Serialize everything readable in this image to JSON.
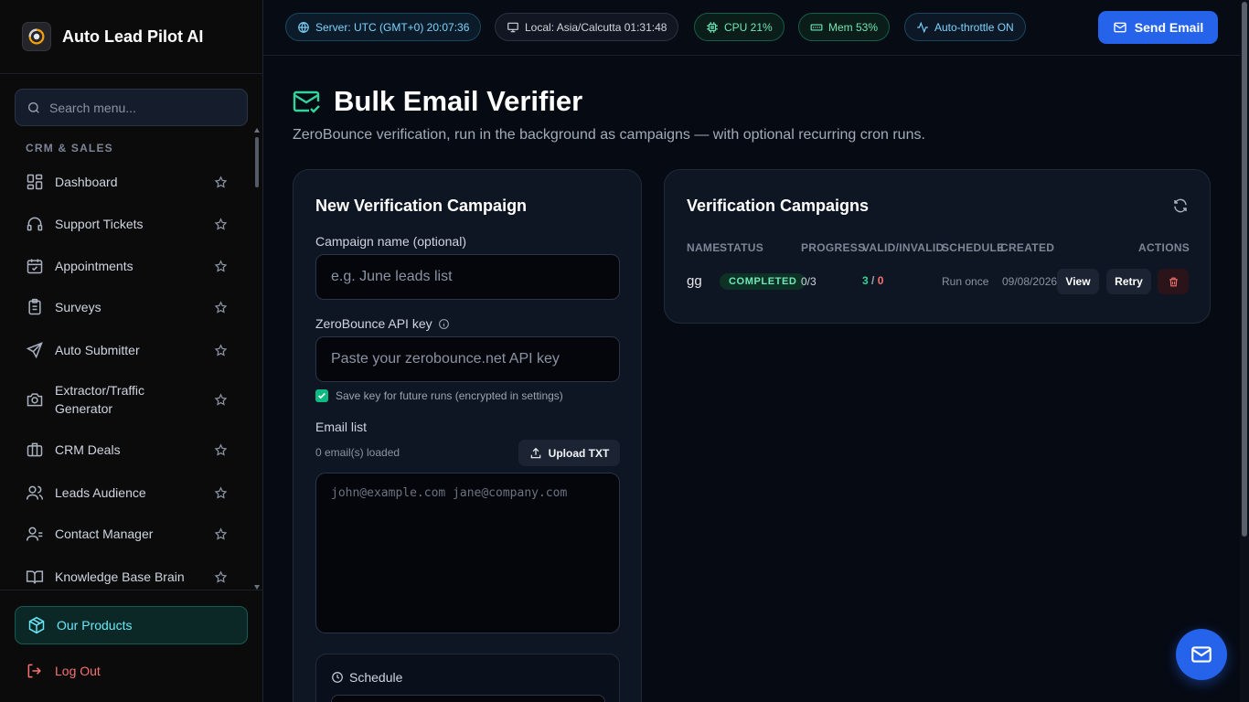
{
  "brand": {
    "title": "Auto Lead Pilot AI"
  },
  "sidebar": {
    "search_placeholder": "Search menu...",
    "section_label": "CRM & SALES",
    "items": [
      {
        "label": "Dashboard",
        "icon": "dashboard-icon"
      },
      {
        "label": "Support Tickets",
        "icon": "headset-icon"
      },
      {
        "label": "Appointments",
        "icon": "calendar-icon"
      },
      {
        "label": "Surveys",
        "icon": "clipboard-icon"
      },
      {
        "label": "Auto Submitter",
        "icon": "send-icon"
      },
      {
        "label": "Extractor/Traffic Generator",
        "icon": "camera-icon"
      },
      {
        "label": "CRM Deals",
        "icon": "briefcase-icon"
      },
      {
        "label": "Leads Audience",
        "icon": "users-icon"
      },
      {
        "label": "Contact Manager",
        "icon": "contacts-icon"
      },
      {
        "label": "Knowledge Base Brain",
        "icon": "book-icon"
      }
    ],
    "products_label": "Our Products",
    "logout_label": "Log Out"
  },
  "topbar": {
    "server": "Server: UTC (GMT+0) 20:07:36",
    "local": "Local: Asia/Calcutta 01:31:48",
    "cpu": "CPU 21%",
    "mem": "Mem 53%",
    "throttle": "Auto-throttle ON",
    "send_email": "Send Email"
  },
  "page": {
    "title": "Bulk Email Verifier",
    "subtitle": "ZeroBounce verification, run in the background as campaigns — with optional recurring cron runs."
  },
  "new_campaign": {
    "heading": "New Verification Campaign",
    "name_label": "Campaign name (optional)",
    "name_placeholder": "e.g. June leads list",
    "api_label": "ZeroBounce API key",
    "api_placeholder": "Paste your zerobounce.net API key",
    "save_key_label": "Save key for future runs (encrypted in settings)",
    "save_key_checked": true,
    "email_list_label": "Email list",
    "loaded_text": "0 email(s) loaded",
    "upload_label": "Upload TXT",
    "emails_placeholder": "john@example.com jane@company.com",
    "schedule_label": "Schedule"
  },
  "campaigns": {
    "heading": "Verification Campaigns",
    "columns": {
      "name": "NAME",
      "status": "STATUS",
      "progress": "PROGRESS",
      "valid_invalid": "VALID/INVALID",
      "schedule": "SCHEDULE",
      "created": "CREATED",
      "actions": "ACTIONS"
    },
    "rows": [
      {
        "name": "gg",
        "status": "COMPLETED",
        "progress": "0/3",
        "valid": "3",
        "separator": "/",
        "invalid": "0",
        "schedule": "Run once",
        "created": "09/08/2026",
        "view_label": "View",
        "retry_label": "Retry"
      }
    ]
  },
  "colors": {
    "accent": "#2563eb",
    "success": "#34d399",
    "danger": "#f87171",
    "cyan": "#67e8f9"
  }
}
